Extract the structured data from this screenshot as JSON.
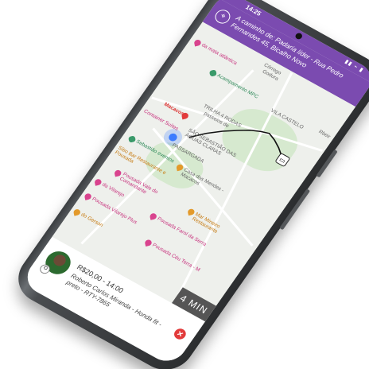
{
  "status": {
    "time": "14:25",
    "icons": "▮▮ ⌁ ▮"
  },
  "header": {
    "address": "A caminho de: Padaria líder - Rua Pedro Fernandes 45, Bicalho Novo"
  },
  "map": {
    "labels": [
      {
        "text": "Córrego",
        "style": "grey"
      },
      {
        "text": "Godura",
        "style": "grey"
      },
      {
        "text": "da mata atlântica",
        "style": "pink"
      },
      {
        "text": "Acampamento MPC",
        "style": "green-t"
      },
      {
        "text": "VILA CASTELO",
        "style": "grey"
      },
      {
        "text": "TRILHA 4 RODAS",
        "style": "grey"
      },
      {
        "text": "passeios de",
        "style": "grey"
      },
      {
        "text": "Macacos",
        "style": "red"
      },
      {
        "text": "SÃO SEBASTIÃO DAS ÁGUAS CLARAS",
        "style": "grey"
      },
      {
        "text": "Container Suítes",
        "style": "pink"
      },
      {
        "text": "PASSARGADA",
        "style": "grey"
      },
      {
        "text": "Sebastião eventos",
        "style": "green-t"
      },
      {
        "text": "Casa dos Mendes - Macacos",
        "style": "grey"
      },
      {
        "text": "Sítio Bar Restaurante e Pousada",
        "style": "orange"
      },
      {
        "text": "Pousada Vale do Comandante",
        "style": "pink"
      },
      {
        "text": "Mar Mineiro Restaurante",
        "style": "orange"
      },
      {
        "text": "da Vilarejo",
        "style": "pink"
      },
      {
        "text": "Pousada Farol da Serra",
        "style": "pink"
      },
      {
        "text": "Pousada Vilarejo Plus",
        "style": "pink"
      },
      {
        "text": "do Gerson",
        "style": "orange"
      },
      {
        "text": "Pousada Céu Terra - M",
        "style": "pink"
      },
      {
        "text": "Rbeir",
        "style": "grey"
      }
    ]
  },
  "eta": "4 MIN",
  "ride": {
    "price_time": "R$20,00 - 14:00",
    "driver": "Roberto Carlos Miranda - Honda fit - preto - RTY-7865"
  },
  "colors": {
    "brand": "#7b4bb0",
    "cancel": "#e23b3b",
    "route": "#111111"
  }
}
